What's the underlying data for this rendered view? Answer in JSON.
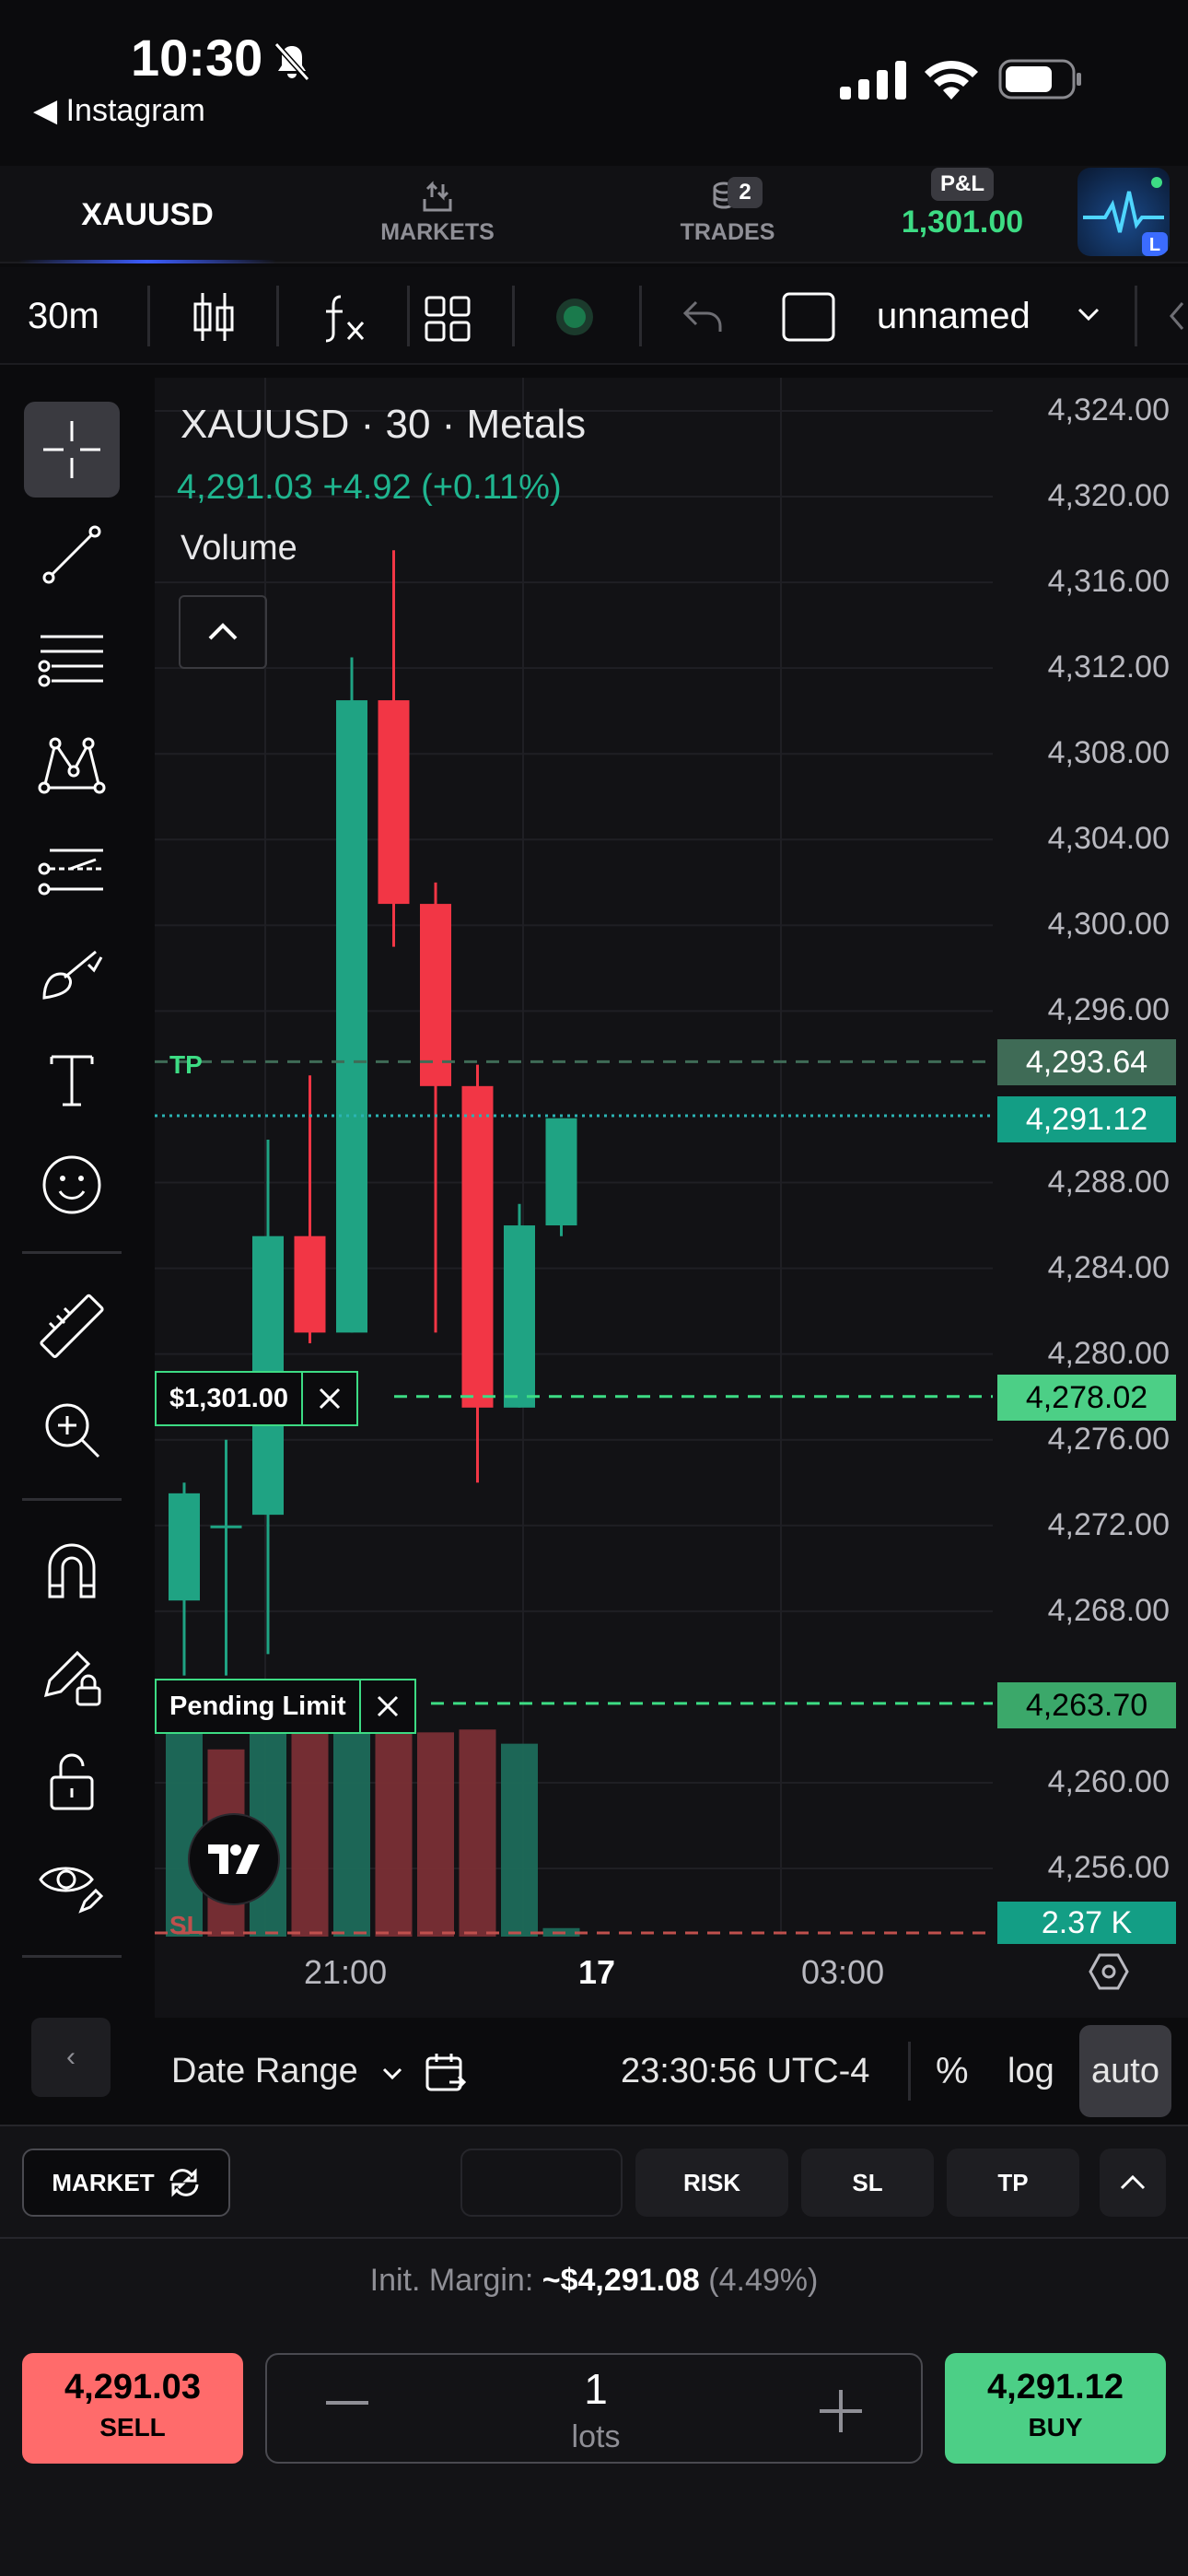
{
  "status_bar": {
    "time": "10:30",
    "back_app": "◀ Instagram"
  },
  "nav": {
    "symbol": "XAUUSD",
    "markets_label": "MARKETS",
    "trades_label": "TRADES",
    "trades_count": "2",
    "pnl_label": "P&L",
    "pnl_value": "1,301.00"
  },
  "toolbar": {
    "interval": "30m",
    "layout_name": "unnamed"
  },
  "chart": {
    "title": "XAUUSD · 30 · Metals",
    "quote": "4,291.03  +4.92 (+0.11%)",
    "volume_label": "Volume",
    "price_scale": [
      "4,324.00",
      "4,320.00",
      "4,316.00",
      "4,312.00",
      "4,308.00",
      "4,304.00",
      "4,300.00",
      "4,296.00",
      "4,288.00",
      "4,284.00",
      "4,280.00",
      "4,276.00",
      "4,272.00",
      "4,268.00",
      "4,260.00",
      "4,256.00"
    ],
    "time_labels": [
      "21:00",
      "17",
      "03:00"
    ],
    "tp_label": "TP",
    "sl_label": "SL",
    "tp_price": "4,293.64",
    "current_price": "4,291.12",
    "position_price": "4,278.02",
    "pending_price": "4,263.70",
    "volume_tag": "2.37 K",
    "position_pnl": "$1,301.00",
    "pending_label": "Pending Limit",
    "colors": {
      "up": "#1fa383",
      "down": "#f23645",
      "tp": "#3ddc84",
      "sl": "#c0504d"
    }
  },
  "chart_data": {
    "type": "candlestick",
    "title": "XAUUSD · 30 · Metals",
    "candles": [
      {
        "o": 4268.5,
        "h": 4274.0,
        "l": 4265.0,
        "c": 4273.5
      },
      {
        "o": 4272.0,
        "h": 4276.0,
        "l": 4265.0,
        "c": 4272.0
      },
      {
        "o": 4272.5,
        "h": 4290.0,
        "l": 4266.0,
        "c": 4285.5
      },
      {
        "o": 4285.5,
        "h": 4293.0,
        "l": 4280.5,
        "c": 4281.0
      },
      {
        "o": 4281.0,
        "h": 4312.5,
        "l": 4281.0,
        "c": 4310.5
      },
      {
        "o": 4310.5,
        "h": 4317.5,
        "l": 4299.0,
        "c": 4301.0
      },
      {
        "o": 4301.0,
        "h": 4302.0,
        "l": 4281.0,
        "c": 4292.5
      },
      {
        "o": 4292.5,
        "h": 4293.5,
        "l": 4274.0,
        "c": 4277.5
      },
      {
        "o": 4277.5,
        "h": 4287.0,
        "l": 4277.5,
        "c": 4286.0
      },
      {
        "o": 4286.0,
        "h": 4291.0,
        "l": 4285.5,
        "c": 4291.0
      }
    ],
    "volume_bars": [
      {
        "dir": "up"
      },
      {
        "dir": "down"
      },
      {
        "dir": "up"
      },
      {
        "dir": "down"
      },
      {
        "dir": "up"
      },
      {
        "dir": "down"
      },
      {
        "dir": "down"
      },
      {
        "dir": "down"
      },
      {
        "dir": "up"
      },
      {
        "dir": "up"
      }
    ],
    "volume_relative": [
      0.76,
      0.66,
      0.74,
      0.72,
      0.76,
      0.75,
      0.72,
      0.73,
      0.68,
      0.03
    ],
    "ylim": [
      4253,
      4326
    ],
    "levels": {
      "tp": 4293.64,
      "current": 4291.12,
      "position": 4278.02,
      "pending": 4263.7
    }
  },
  "bottom_bar": {
    "back": "‹",
    "date_range": "Date Range",
    "clock": "23:30:56 UTC-4",
    "percent": "%",
    "log": "log",
    "auto": "auto"
  },
  "order_panel": {
    "market_label": "MARKET",
    "risk_label": "RISK",
    "sl_label": "SL",
    "tp_label": "TP",
    "init_margin_label": "Init. Margin:",
    "init_margin_value": "~$4,291.08",
    "init_margin_pct": "(4.49%)",
    "sell_price": "4,291.03",
    "sell_label": "SELL",
    "buy_price": "4,291.12",
    "buy_label": "BUY",
    "quantity": "1",
    "quantity_unit": "lots"
  }
}
